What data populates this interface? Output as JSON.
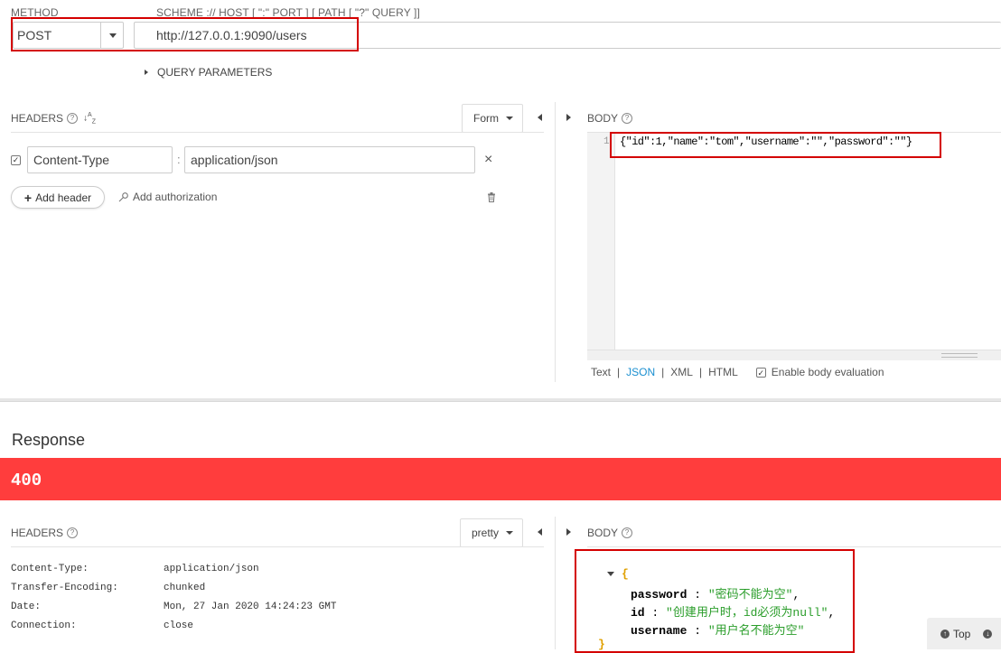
{
  "request": {
    "method_label": "METHOD",
    "url_label": "SCHEME :// HOST [ \":\" PORT ] [ PATH [ \"?\" QUERY ]]",
    "method_value": "POST",
    "url_value": "http://127.0.0.1:9090/users",
    "query_parameters_label": "QUERY PARAMETERS",
    "headers_label": "HEADERS",
    "help_glyph": "?",
    "sort_glyph": "↓A̲Z",
    "form_button": "Form",
    "body_label": "BODY",
    "header_row": {
      "name": "Content-Type",
      "separator": ":",
      "value": "application/json",
      "remove_glyph": "×"
    },
    "add_header": "Add header",
    "add_authorization": "Add authorization",
    "body_line_number": "1",
    "body_content": "{\"id\":1,\"name\":\"tom\",\"username\":\"\",\"password\":\"\"}",
    "body_formats": {
      "text": "Text",
      "json": "JSON",
      "xml": "XML",
      "html": "HTML",
      "sep": "|"
    },
    "enable_body_evaluation": "Enable body evaluation"
  },
  "response": {
    "title": "Response",
    "status_code": "400",
    "status_color": "#ff3d3d",
    "headers_label": "HEADERS",
    "pretty_button": "pretty",
    "body_label": "BODY",
    "headers": [
      {
        "name": "Content-Type:",
        "value": "application/json"
      },
      {
        "name": "Transfer-Encoding:",
        "value": "chunked"
      },
      {
        "name": "Date:",
        "value": "Mon, 27 Jan 2020 14:24:23 GMT"
      },
      {
        "name": "Connection:",
        "value": "close"
      }
    ],
    "body_open": "{",
    "body_close": "}",
    "body_fields": [
      {
        "key": "password",
        "sep": " : ",
        "value": "\"密码不能为空\"",
        "comma": ","
      },
      {
        "key": "id",
        "sep": " : ",
        "value": "\"创建用户时，id必须为null\"",
        "comma": ","
      },
      {
        "key": "username",
        "sep": " : ",
        "value": "\"用户名不能为空\"",
        "comma": ""
      }
    ],
    "top_button": "Top"
  },
  "colors": {
    "accent_red": "#d40000",
    "json_link": "#1a8fd0",
    "string_green": "#2a9d2a",
    "brace_orange": "#e0a000"
  }
}
